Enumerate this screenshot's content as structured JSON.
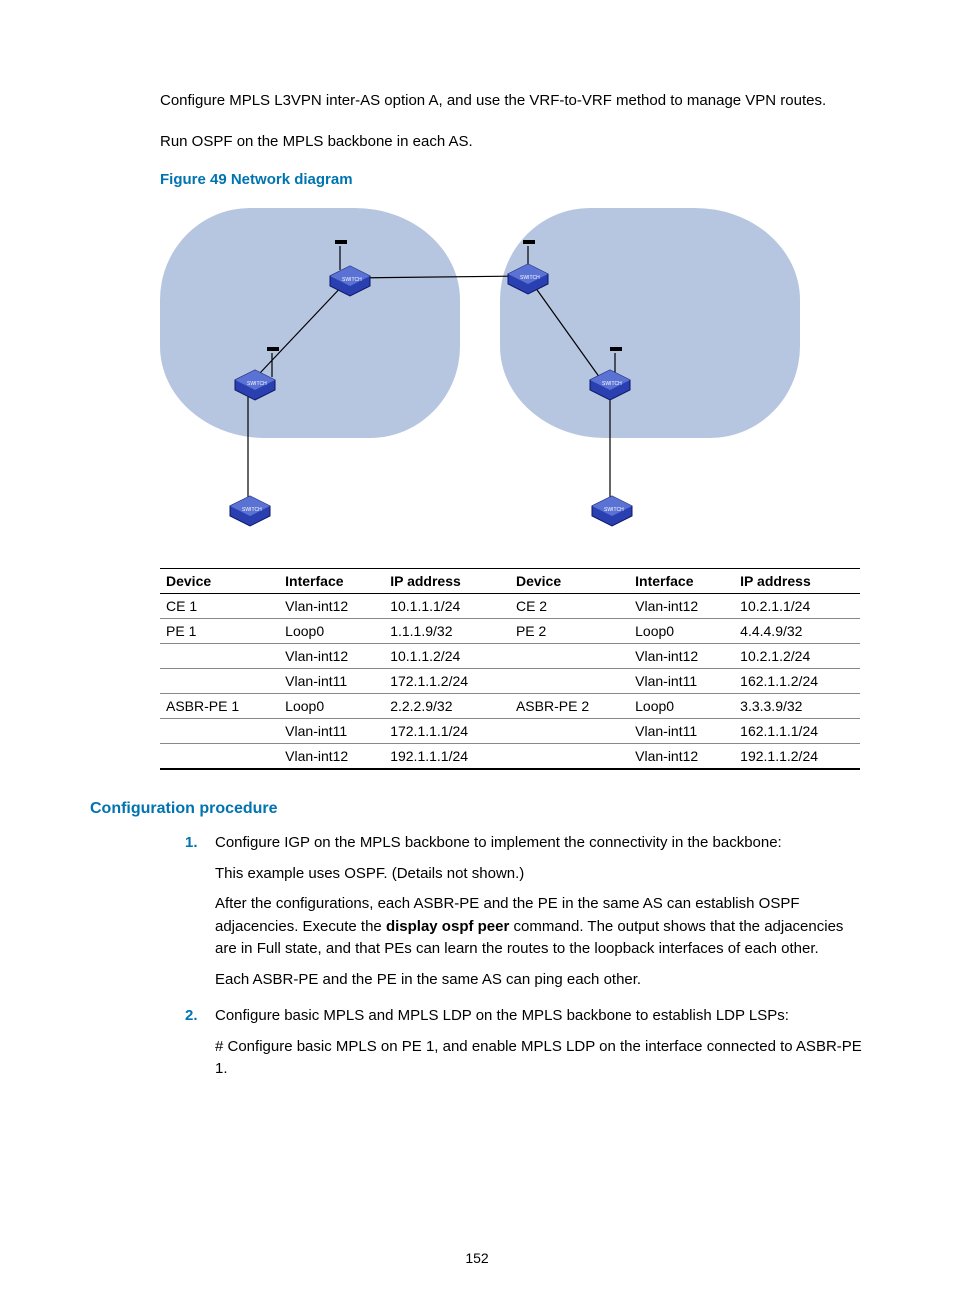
{
  "intro": {
    "p1": "Configure MPLS L3VPN inter-AS option A, and use the VRF-to-VRF method to manage VPN routes.",
    "p2": "Run OSPF on the MPLS backbone in each AS."
  },
  "figure_title": "Figure 49 Network diagram",
  "table": {
    "headers": [
      "Device",
      "Interface",
      "IP address",
      "Device",
      "Interface",
      "IP address"
    ],
    "rows": [
      [
        "CE 1",
        "Vlan-int12",
        "10.1.1.1/24",
        "CE 2",
        "Vlan-int12",
        "10.2.1.1/24"
      ],
      [
        "PE 1",
        "Loop0",
        "1.1.1.9/32",
        "PE 2",
        "Loop0",
        "4.4.4.9/32"
      ],
      [
        "",
        "Vlan-int12",
        "10.1.1.2/24",
        "",
        "Vlan-int12",
        "10.2.1.2/24"
      ],
      [
        "",
        "Vlan-int11",
        "172.1.1.2/24",
        "",
        "Vlan-int11",
        "162.1.1.2/24"
      ],
      [
        "ASBR-PE 1",
        "Loop0",
        "2.2.2.9/32",
        "ASBR-PE 2",
        "Loop0",
        "3.3.3.9/32"
      ],
      [
        "",
        "Vlan-int11",
        "172.1.1.1/24",
        "",
        "Vlan-int11",
        "162.1.1.1/24"
      ],
      [
        "",
        "Vlan-int12",
        "192.1.1.1/24",
        "",
        "Vlan-int12",
        "192.1.1.2/24"
      ]
    ]
  },
  "section_title": "Configuration procedure",
  "steps": {
    "s1": {
      "num": "1.",
      "lead": "Configure IGP on the MPLS backbone to implement the connectivity in the backbone:",
      "p1": "This example uses OSPF. (Details not shown.)",
      "p2a": "After the configurations, each ASBR-PE and the PE in the same AS can establish OSPF adjacencies. Execute the ",
      "p2b": "display ospf peer",
      "p2c": " command. The output shows that the adjacencies are in Full state, and that PEs can learn the routes to the loopback interfaces of each other.",
      "p3": "Each ASBR-PE and the PE in the same AS can ping each other."
    },
    "s2": {
      "num": "2.",
      "lead": "Configure basic MPLS and MPLS LDP on the MPLS backbone to establish LDP LSPs:",
      "p1": "# Configure basic MPLS on PE 1, and enable MPLS LDP on the interface connected to ASBR-PE 1."
    }
  },
  "page_num": "152"
}
